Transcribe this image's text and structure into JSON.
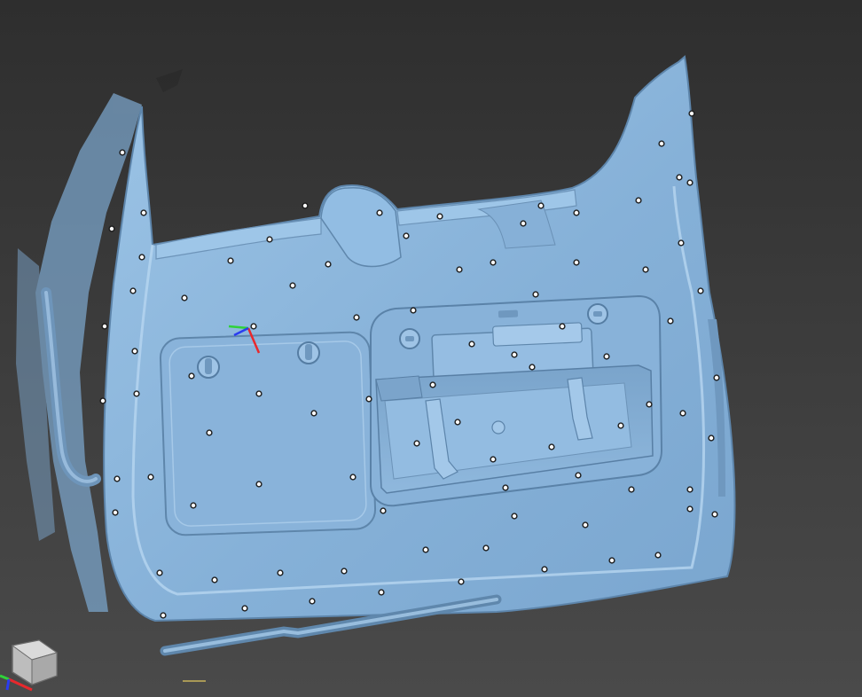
{
  "scene": {
    "background_top": "#2e2e2e",
    "background_bottom": "#4a4a4a",
    "mesh_color": "#8bb6dc",
    "mesh_shadow": "#5f87ac",
    "mesh_highlight": "#b2d2ee",
    "marker_fill": "#ffffff",
    "marker_ring": "#1b1b1b",
    "object": "scanned-tailgate-inner-panel",
    "target_markers": "reference-target-dots"
  },
  "axis_triad": {
    "x_color": "#e8282c",
    "y_color": "#2fd13a",
    "z_color": "#2a3cf0"
  },
  "navigation_cube": {
    "icon": "view-cube-icon",
    "face_color": "#c9c9c9",
    "x_color": "#e8282c",
    "y_color": "#2fd13a",
    "z_color": "#2a3cf0"
  }
}
